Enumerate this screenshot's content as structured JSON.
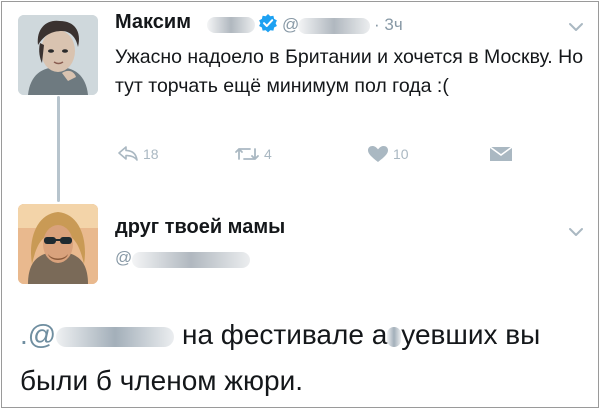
{
  "tweet": {
    "author_name": "Максим",
    "handle_prefix": "@",
    "time": "· 3ч",
    "text": "Ужасно надоело в Британии и хочется в Москву. Но тут торчать ещё минимум пол года :(",
    "counts": {
      "reply": "18",
      "retweet": "4",
      "like": "10"
    }
  },
  "reply": {
    "author_name": "друг твоей мамы",
    "handle_prefix": "@",
    "mention_prefix": ".@",
    "text_part1": "на фестивале а",
    "text_part2": "уевших вы",
    "text_line2": "были б членом жюри."
  },
  "icons": {
    "verified": "verified-badge-icon",
    "caret": "chevron-down-icon",
    "reply": "reply-icon",
    "retweet": "retweet-icon",
    "like": "heart-icon",
    "dm": "direct-message-icon"
  },
  "colors": {
    "text": "#14171a",
    "secondary": "#8899a6",
    "action": "#aab8c2",
    "verified": "#1da1f2",
    "thread_line": "#b7c4cd"
  }
}
